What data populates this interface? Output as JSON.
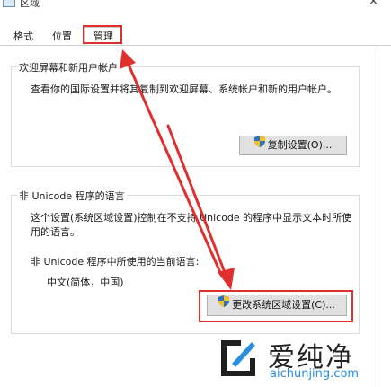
{
  "window": {
    "title": "区域",
    "close_glyph": "×"
  },
  "tabs": [
    {
      "label": "格式"
    },
    {
      "label": "位置"
    },
    {
      "label": "管理",
      "active": true
    }
  ],
  "welcome_group": {
    "legend": "欢迎屏幕和新用户帐户",
    "description": "查看你的国际设置并将其复制到欢迎屏幕、系统帐户和新的用户帐户。",
    "copy_button_label": "复制设置(O)..."
  },
  "unicode_group": {
    "legend": "非 Unicode 程序的语言",
    "description_line1": "这个设置(系统区域设置)控制在不支持 Unicode 的程序中显示文本时所使",
    "description_line2": "用的语言。",
    "current_label": "非 Unicode 程序中所使用的当前语言:",
    "current_value": "中文(简体，中国)",
    "change_button_label": "更改系统区域设置(C)..."
  },
  "watermark": {
    "text": "爱纯净",
    "url": "aichunjing.com"
  },
  "colors": {
    "annotation_red": "#e0302e",
    "button_bg": "#e1e1e1",
    "watermark_blue": "#2a8fe0"
  },
  "icons": [
    "window-icon",
    "close-icon",
    "shield-icon",
    "watermark-logo-icon"
  ]
}
